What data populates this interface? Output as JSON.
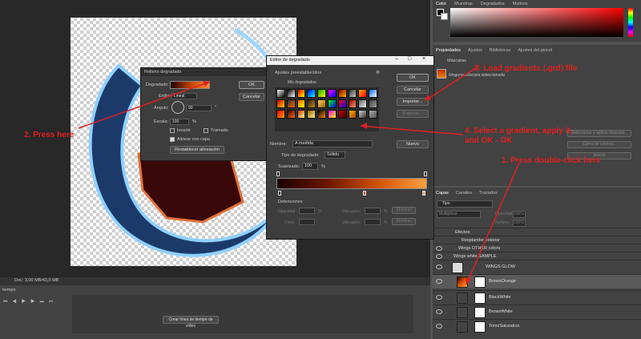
{
  "colors": {
    "annotation": "#e02020",
    "accent_dark": "#1a1a1a"
  },
  "status": {
    "doc_info": "Doc: 3,00 MB/43,0 MB"
  },
  "timeline": {
    "title": "tiempo",
    "create_button": "Crear línea de tiempo de vídeo"
  },
  "color_panel": {
    "tabs": [
      "Color",
      "Muestras",
      "Degradados",
      "Motivos"
    ]
  },
  "properties": {
    "tabs": [
      "Propiedades",
      "Ajustes",
      "Bibliotecas",
      "Ajustes del pincel"
    ],
    "section": "Máscaras",
    "mask_label": "Ninguna máscara seleccionada",
    "buttons": [
      "Seleccionar y aplicar máscara...",
      "Gama de colores...",
      "Invertir"
    ]
  },
  "layers": {
    "tabs": [
      "Capas",
      "Canales",
      "Trazados"
    ],
    "search_placeholder": "Tipo",
    "blend_mode": "Multiplicar",
    "opacity_label": "Opacidad:",
    "opacity_value": "100%",
    "fill_label": "Relleno:",
    "fill_value": "100%",
    "rows": [
      {
        "name": "Efectos"
      },
      {
        "name": "Resplandor exterior"
      },
      {
        "name": "Wings OTHER colors"
      },
      {
        "name": "Wings white SAMPLE"
      },
      {
        "name": "WINGS GLOW"
      },
      {
        "name": "BrownOrange"
      },
      {
        "name": "BlackWhite"
      },
      {
        "name": "BrownWhite"
      },
      {
        "name": "Tono/Saturation"
      }
    ]
  },
  "fill_dialog": {
    "title": "Relleno degradado",
    "gradient_label": "Degradado:",
    "style_label": "Estilo:",
    "style_value": "Lineal",
    "angle_label": "Ángulo:",
    "angle_value": "90",
    "scale_label": "Escala:",
    "scale_value": "100",
    "percent": "%",
    "degree": "°",
    "invert_label": "Invertir",
    "dither_label": "Tramado",
    "align_label": "Alinear con capa",
    "reset_button": "Restablecer alineación",
    "ok_button": "OK",
    "cancel_button": "Cancelar"
  },
  "editor_dialog": {
    "title": "Editor de degradado",
    "presets_label": "Ajustes preestablecidos",
    "folder_name": "Mis degradados",
    "name_label": "Nombre:",
    "name_value": "A medida",
    "type_label": "Tipo de degradado:",
    "type_value": "Sólido",
    "smooth_label": "Suavizado:",
    "smooth_value": "100",
    "percent": "%",
    "stops_label": "Detenciones",
    "opacity_label": "Opacidad:",
    "location_label": "Ubicación:",
    "color_label": "Color:",
    "delete_label": "Eliminar",
    "ok_button": "OK",
    "cancel_button": "Cancelar",
    "import_button": "Importar...",
    "export_button": "Exportar...",
    "new_button": "Nuevo"
  },
  "annotations": {
    "press_here": "2. Press here",
    "load_gradients": "3. Load gradients (.grd) file",
    "select_gradient_1": "4. Select a gradient, apply it,",
    "select_gradient_2": "and OK - OK",
    "double_click": "1. Press double-click here"
  }
}
